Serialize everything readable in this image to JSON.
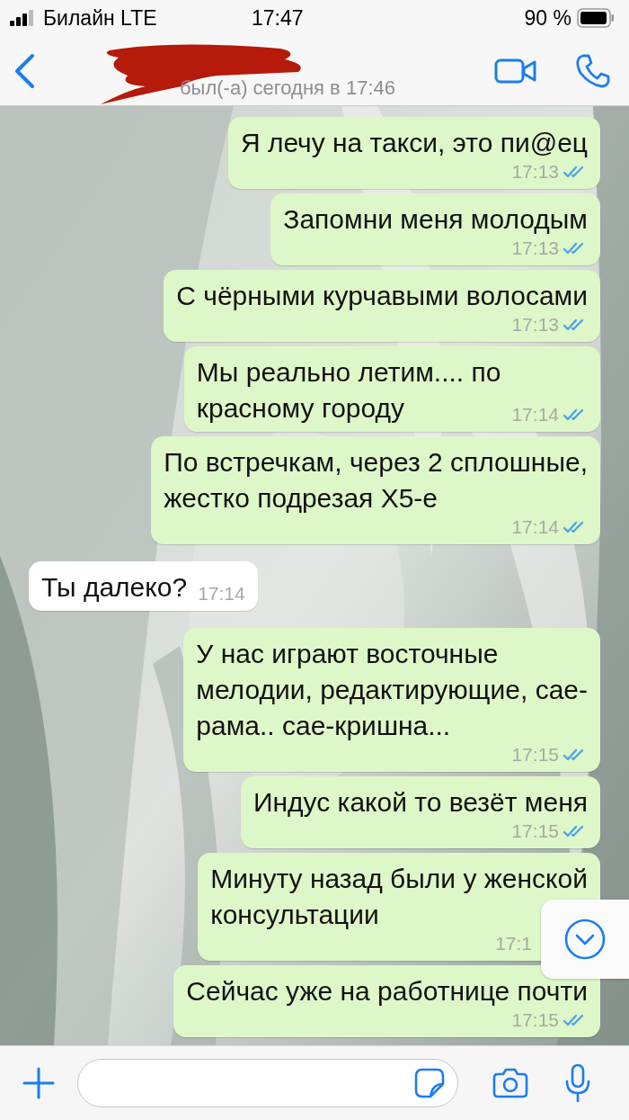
{
  "status_bar": {
    "carrier": "Билайн LTE",
    "time": "17:47",
    "battery": "90 %"
  },
  "header": {
    "last_seen": "был(-а) сегодня в 17:46"
  },
  "messages": [
    {
      "kind": "outgoing",
      "text": "Я лечу на такси, это пи@ец",
      "time": "17:13",
      "read": true
    },
    {
      "kind": "outgoing",
      "text": "Запомни меня молодым",
      "time": "17:13",
      "read": true
    },
    {
      "kind": "outgoing",
      "text": "С чёрными курчавыми волосами",
      "time": "17:13",
      "read": true
    },
    {
      "kind": "outgoing",
      "text": "Мы реально летим.... по\nкрасному городу",
      "time": "17:14",
      "read": true
    },
    {
      "kind": "outgoing",
      "text": "По встречкам, через 2 сплошные,\nжестко подрезая Х5-е",
      "time": "17:14",
      "read": true
    },
    {
      "kind": "incoming",
      "text": "Ты далеко?",
      "time": "17:14"
    },
    {
      "kind": "outgoing",
      "text": "У нас играют восточные\nмелодии, редактирующие, сае-\nрама.. сае-кришна...",
      "time": "17:15",
      "read": true
    },
    {
      "kind": "outgoing",
      "text": "Индус какой то везёт меня",
      "time": "17:15",
      "read": true
    },
    {
      "kind": "outgoing",
      "text": "Минуту назад были у женской\nконсультации",
      "time": "17:1"
    },
    {
      "kind": "outgoing",
      "text": "Сейчас уже на работнице почти",
      "time": "17:15",
      "read": true
    }
  ]
}
